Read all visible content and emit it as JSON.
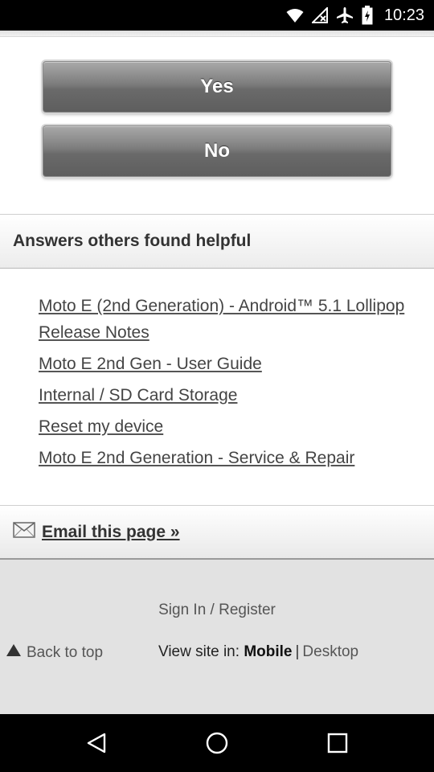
{
  "status_bar": {
    "time": "10:23",
    "icons": [
      "wifi-icon",
      "no-signal-icon",
      "airplane-icon",
      "battery-icon"
    ]
  },
  "vote": {
    "yes_label": "Yes",
    "no_label": "No"
  },
  "answers": {
    "header": "Answers others found helpful",
    "items": [
      {
        "label": "Moto E (2nd Generation) - Android™ 5.1 Lollipop Release Notes"
      },
      {
        "label": "Moto E 2nd Gen - User Guide"
      },
      {
        "label": "Internal / SD Card Storage"
      },
      {
        "label": "Reset my device"
      },
      {
        "label": "Moto E 2nd Generation - Service & Repair"
      }
    ]
  },
  "email": {
    "label": "Email this page »",
    "icon": "envelope-icon"
  },
  "footer": {
    "sign_in": "Sign In / Register",
    "back_to_top": "Back to top",
    "view_site_prefix": "View site in:",
    "view_site_mobile": "Mobile",
    "view_site_sep": "|",
    "view_site_desktop": "Desktop"
  },
  "nav_bar": {
    "icons": [
      "back-icon",
      "home-icon",
      "recents-icon"
    ]
  }
}
